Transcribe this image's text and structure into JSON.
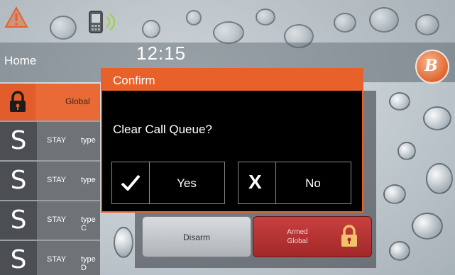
{
  "status_bar": {
    "alert_icon": "alert-triangle-icon",
    "phone_icon": "phone-message-icon"
  },
  "header": {
    "home_label": "Home",
    "time": "12:15",
    "brand_letter": "B"
  },
  "partition_list": {
    "global_row": {
      "label": "Global",
      "icon": "lock-icon"
    },
    "rows": [
      {
        "badge": "S",
        "mode": "STAY",
        "type": "type"
      },
      {
        "badge": "S",
        "mode": "STAY",
        "type": "type"
      },
      {
        "badge": "S",
        "mode": "STAY",
        "type": "type C"
      },
      {
        "badge": "S",
        "mode": "STAY",
        "type": "type D"
      }
    ]
  },
  "arming_panel": {
    "disarm_label": "Disarm",
    "armed_line1": "Armed",
    "armed_line2": "Global",
    "armed_icon": "lock-icon"
  },
  "dialog": {
    "title": "Confirm",
    "message": "Clear Call Queue?",
    "yes_label": "Yes",
    "yes_icon": "checkmark-icon",
    "no_label": "No",
    "no_glyph": "X",
    "no_icon": "x-icon"
  },
  "colors": {
    "accent_orange": "#e8612b",
    "armed_red": "#b33030",
    "dialog_bg": "#000000"
  }
}
